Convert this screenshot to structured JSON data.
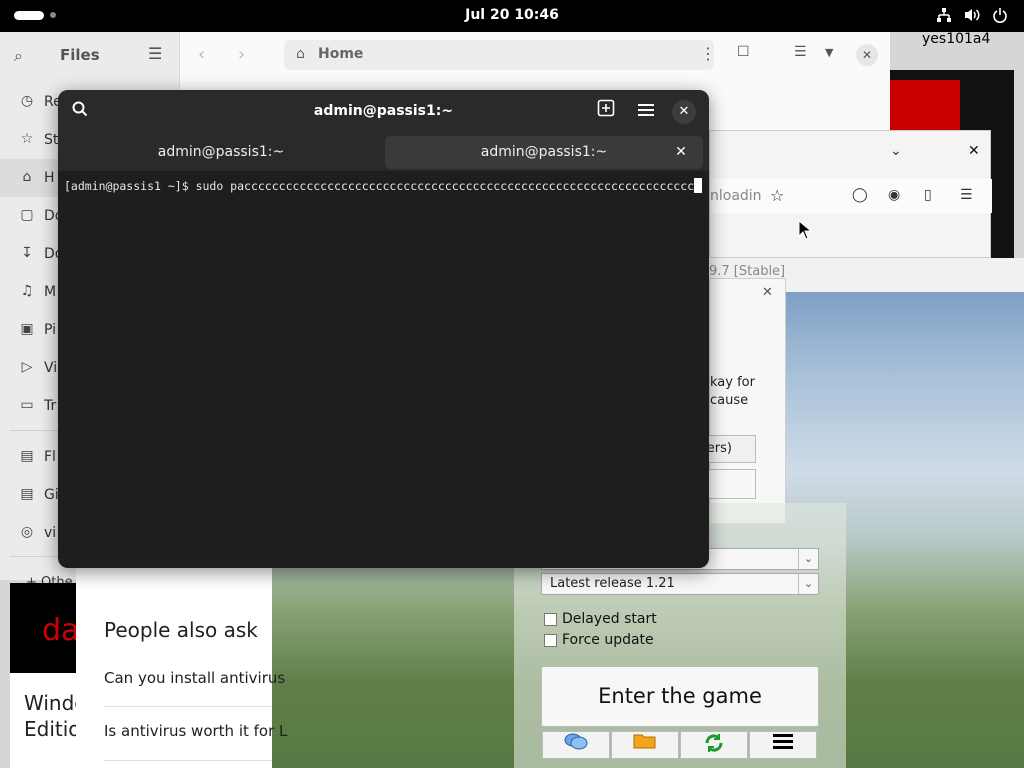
{
  "topbar": {
    "clock": "Jul 20  10:46",
    "icons": [
      "network-icon",
      "volume-icon",
      "power-icon"
    ]
  },
  "user_label": "yes101a4",
  "files": {
    "title": "Files",
    "path_label": "Home",
    "sidebar": [
      {
        "icon": "clock-icon",
        "label": "Re"
      },
      {
        "icon": "star-icon",
        "label": "St"
      },
      {
        "icon": "home-icon",
        "label": "H"
      },
      {
        "icon": "document-icon",
        "label": "Do"
      },
      {
        "icon": "download-icon",
        "label": "Do"
      },
      {
        "icon": "music-icon",
        "label": "M"
      },
      {
        "icon": "picture-icon",
        "label": "Pi"
      },
      {
        "icon": "video-icon",
        "label": "Vi"
      },
      {
        "icon": "trash-icon",
        "label": "Tr"
      },
      {
        "icon": "drive-icon",
        "label": "Fl"
      },
      {
        "icon": "drive-icon",
        "label": "Gi"
      },
      {
        "icon": "disc-icon",
        "label": "vi"
      }
    ],
    "other_label": "+ Othe"
  },
  "browser": {
    "url_fragment": "nloadin"
  },
  "scene_strip_text": "9.7 [Stable]",
  "dialog": {
    "text_line1": "kay for",
    "text_line2": "cause",
    "button_label": "sers)"
  },
  "launcher": {
    "select1_value": "",
    "select2_value": "Latest release 1.21",
    "delayed_start_label": "Delayed start",
    "force_update_label": "Force update",
    "enter_button": "Enter the game",
    "tools": [
      "chat-icon",
      "folder-icon",
      "refresh-icon",
      "menu-icon"
    ]
  },
  "search_page": {
    "people_also_ask": "People also ask",
    "questions": [
      "Can you install antivirus",
      "Is antivirus worth it for L"
    ],
    "red_thumb_text": "da",
    "win_thumb_line1": "Windo",
    "win_thumb_line2": "Edition"
  },
  "terminal": {
    "title": "admin@passis1:~",
    "tabs": [
      "admin@passis1:~",
      "admin@passis1:~"
    ],
    "prompt": "[admin@passis1 ~]$ ",
    "command": "sudo paccccccccccccccccccccccccccccccccccccccccccccccccccccccccccccccccc"
  }
}
